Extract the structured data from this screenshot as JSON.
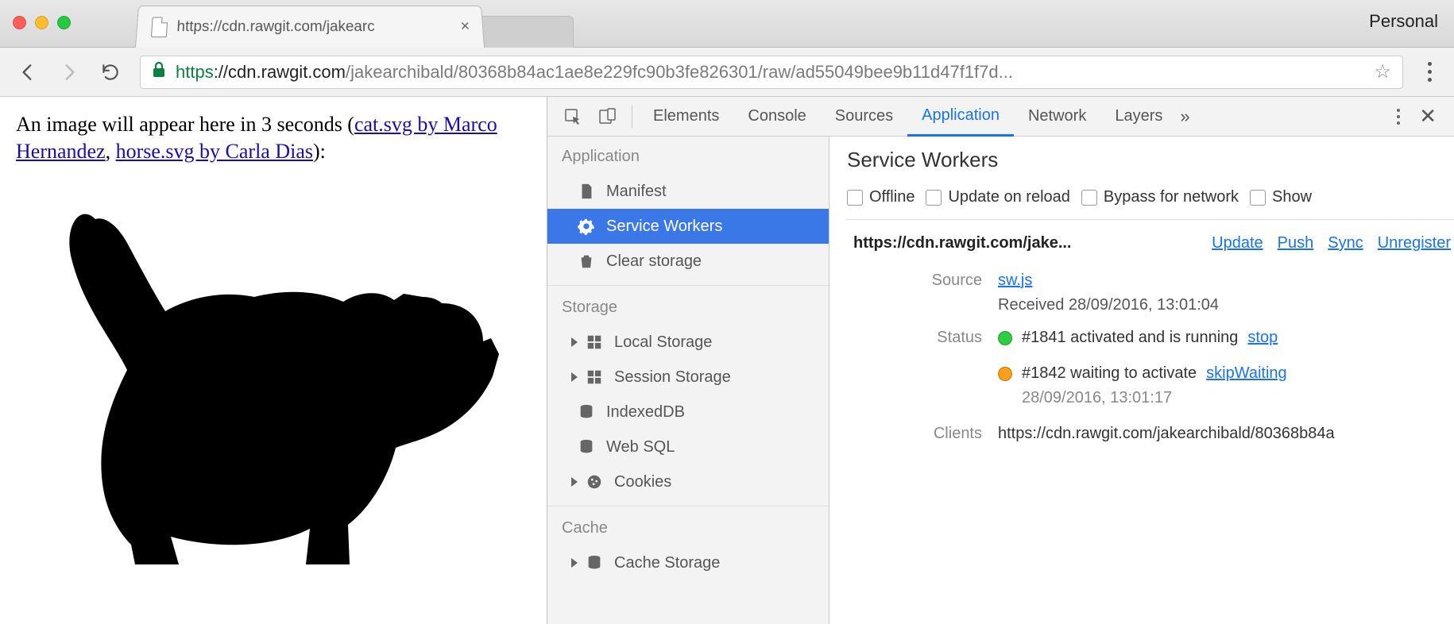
{
  "browser": {
    "personal_label": "Personal",
    "tab_title": "https://cdn.rawgit.com/jakearc",
    "url_scheme": "https",
    "url_host": "://cdn.rawgit.com",
    "url_path": "/jakearchibald/80368b84ac1ae8e229fc90b3fe826301/raw/ad55049bee9b11d47f1f7d..."
  },
  "page": {
    "text_prefix": "An image will appear here in 3 seconds (",
    "link1": "cat.svg by Marco Hernandez",
    "sep": ", ",
    "link2": "horse.svg by Carla Dias",
    "text_suffix": "):"
  },
  "devtools": {
    "tabs": [
      "Elements",
      "Console",
      "Sources",
      "Application",
      "Network",
      "Layers"
    ],
    "active_tab": "Application",
    "sidebar": {
      "group_app": "Application",
      "app_items": [
        "Manifest",
        "Service Workers",
        "Clear storage"
      ],
      "group_storage": "Storage",
      "storage_items": [
        "Local Storage",
        "Session Storage",
        "IndexedDB",
        "Web SQL",
        "Cookies"
      ],
      "group_cache": "Cache",
      "cache_items": [
        "Cache Storage"
      ]
    },
    "sw": {
      "title": "Service Workers",
      "checks": [
        "Offline",
        "Update on reload",
        "Bypass for network",
        "Show"
      ],
      "origin": "https://cdn.rawgit.com/jake...",
      "actions": [
        "Update",
        "Push",
        "Sync",
        "Unregister"
      ],
      "source_label": "Source",
      "source_link": "sw.js",
      "source_received": "Received 28/09/2016, 13:01:04",
      "status_label": "Status",
      "status1_text": "#1841 activated and is running",
      "status1_action": "stop",
      "status2_text": "#1842 waiting to activate",
      "status2_action": "skipWaiting",
      "status2_time": "28/09/2016, 13:01:17",
      "clients_label": "Clients",
      "clients_value": "https://cdn.rawgit.com/jakearchibald/80368b84a"
    }
  }
}
